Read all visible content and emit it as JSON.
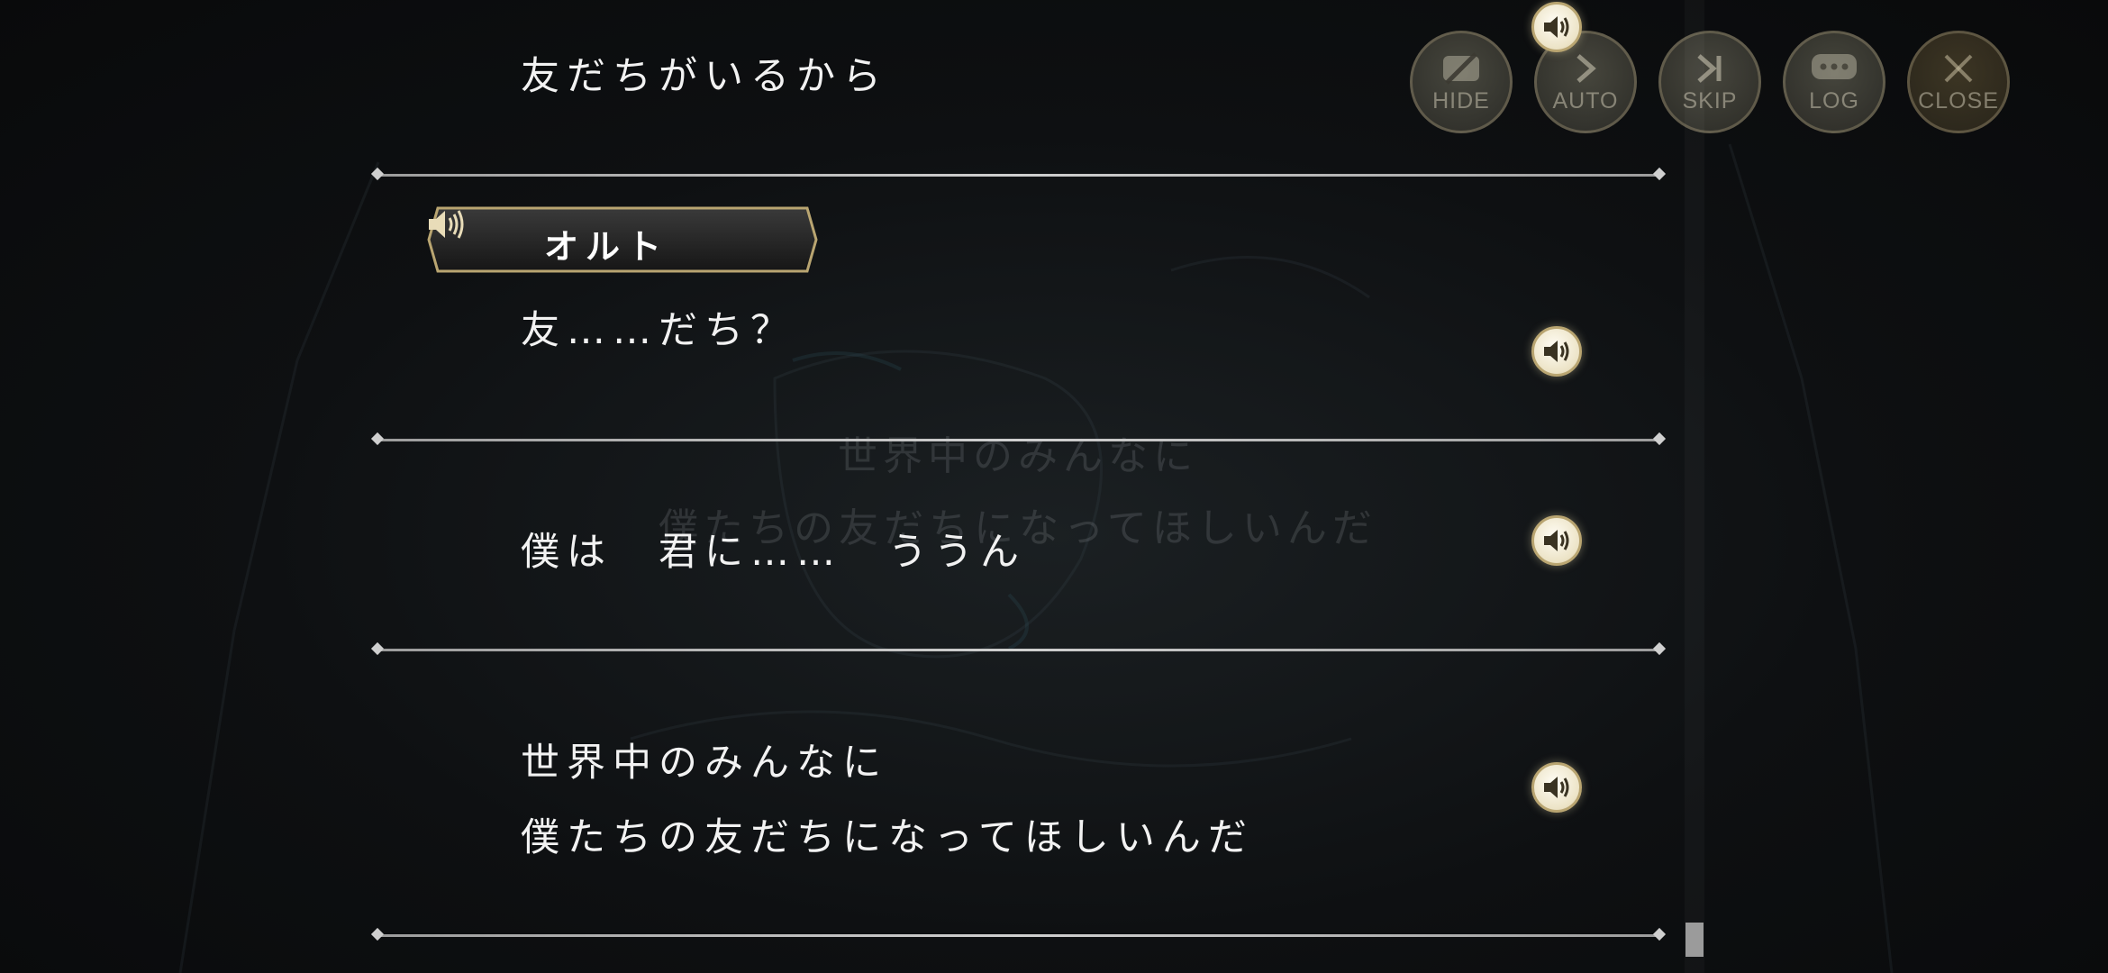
{
  "hud": {
    "buttons": [
      {
        "label": "HIDE",
        "icon": "hide-icon"
      },
      {
        "label": "AUTO",
        "icon": "play-icon"
      },
      {
        "label": "SKIP",
        "icon": "skip-icon"
      },
      {
        "label": "LOG",
        "icon": "chat-bubble-icon"
      },
      {
        "label": "CLOSE",
        "icon": "close-icon"
      }
    ]
  },
  "background": {
    "caption_line_1": "世界中のみんなに",
    "caption_line_2": "僕たちの友だちになってほしいんだ"
  },
  "log": {
    "entries": [
      {
        "speaker": "",
        "lines": [
          "友だちがいるから"
        ]
      },
      {
        "speaker": "オルト",
        "lines": [
          "友……だち？"
        ]
      },
      {
        "speaker": "",
        "lines": [
          "僕は　君に……　ううん"
        ]
      },
      {
        "speaker": "",
        "lines": [
          "世界中のみんなに",
          "僕たちの友だちになってほしいんだ"
        ]
      }
    ]
  },
  "colors": {
    "accent_gold": "#b9a571",
    "text": "#f2f2f2",
    "background": "#0b0c0d"
  }
}
